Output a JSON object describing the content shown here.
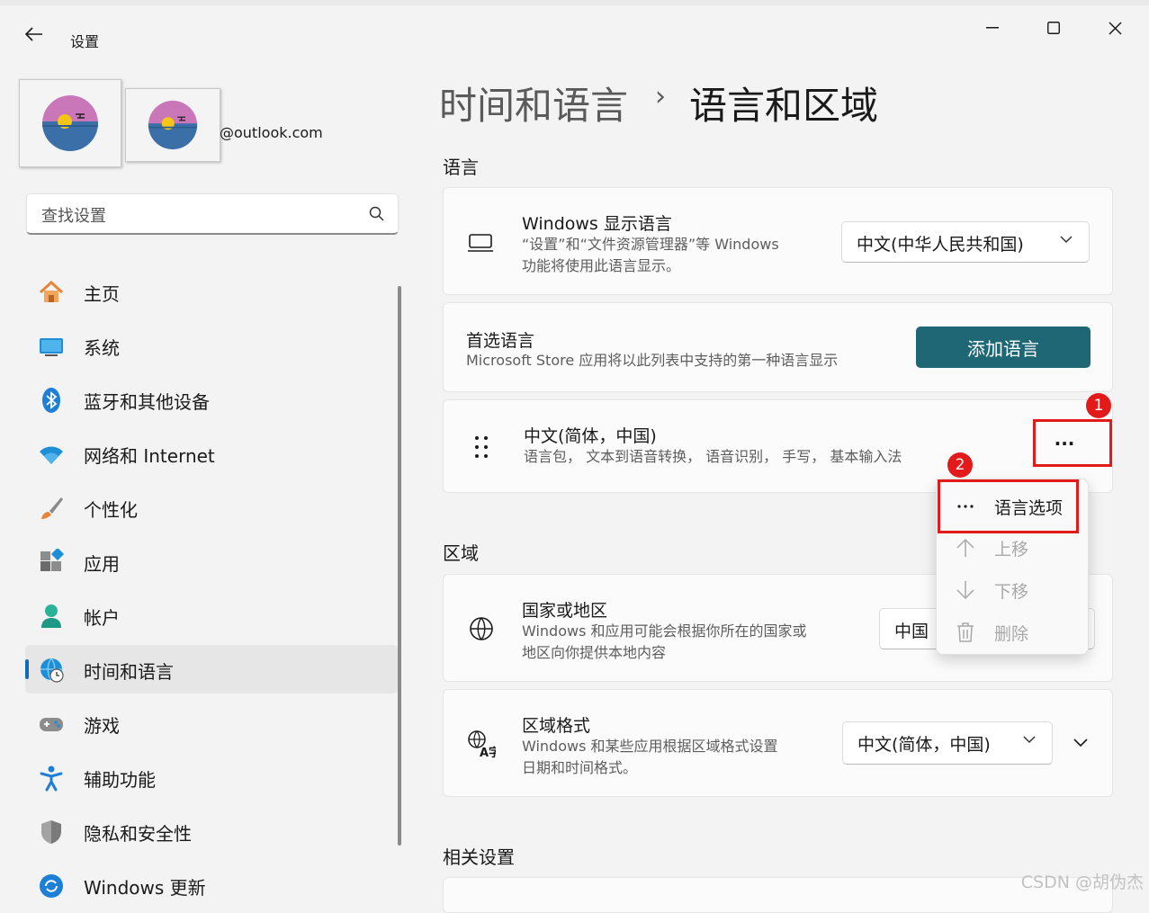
{
  "window": {
    "title": "设置",
    "buttons": [
      "minimize",
      "maximize",
      "close"
    ]
  },
  "profile": {
    "email": "@outlook.com"
  },
  "search": {
    "placeholder": "查找设置"
  },
  "nav": {
    "items": [
      {
        "label": "主页",
        "icon": "home-icon"
      },
      {
        "label": "系统",
        "icon": "system-icon"
      },
      {
        "label": "蓝牙和其他设备",
        "icon": "bluetooth-icon"
      },
      {
        "label": "网络和 Internet",
        "icon": "wifi-icon"
      },
      {
        "label": "个性化",
        "icon": "brush-icon"
      },
      {
        "label": "应用",
        "icon": "apps-icon"
      },
      {
        "label": "帐户",
        "icon": "account-icon"
      },
      {
        "label": "时间和语言",
        "icon": "globe-clock-icon",
        "active": true
      },
      {
        "label": "游戏",
        "icon": "gamepad-icon"
      },
      {
        "label": "辅助功能",
        "icon": "accessibility-icon"
      },
      {
        "label": "隐私和安全性",
        "icon": "shield-icon"
      },
      {
        "label": "Windows 更新",
        "icon": "update-icon"
      }
    ]
  },
  "breadcrumb": {
    "parent": "时间和语言",
    "separator": "›",
    "current": "语言和区域"
  },
  "language_section": {
    "title": "语言",
    "display_language": {
      "title": "Windows 显示语言",
      "desc_line1": "“设置”和“文件资源管理器”等 Windows",
      "desc_line2": "功能将使用此语言显示。",
      "value": "中文(中华人民共和国)"
    },
    "preferred": {
      "title": "首选语言",
      "desc": "Microsoft Store 应用将以此列表中支持的第一种语言显示",
      "button": "添加语言"
    },
    "language_item": {
      "title": "中文(简体，中国)",
      "desc": "语言包， 文本到语音转换， 语音识别， 手写， 基本输入法",
      "more": "···"
    }
  },
  "context_menu": {
    "items": [
      {
        "label": "语言选项",
        "icon": "more-icon",
        "enabled": true
      },
      {
        "label": "上移",
        "icon": "arrow-up-icon",
        "enabled": false
      },
      {
        "label": "下移",
        "icon": "arrow-down-icon",
        "enabled": false
      },
      {
        "label": "删除",
        "icon": "trash-icon",
        "enabled": false
      }
    ]
  },
  "region_section": {
    "title": "区域",
    "country": {
      "title": "国家或地区",
      "desc_line1": "Windows 和应用可能会根据你所在的国家或",
      "desc_line2": "地区向你提供本地内容",
      "value": "中国"
    },
    "format": {
      "title": "区域格式",
      "desc_line1": "Windows 和某些应用根据区域格式设置",
      "desc_line2": "日期和时间格式。",
      "value": "中文(简体，中国)"
    }
  },
  "related_section": {
    "title": "相关设置"
  },
  "annotations": {
    "badge1": "1",
    "badge2": "2",
    "color": "#e21a1a"
  },
  "watermark": "CSDN @胡伪杰",
  "colors": {
    "accent_button": "#1f6774",
    "nav_indicator": "#0f6cbd",
    "background": "#f3f3f3"
  }
}
